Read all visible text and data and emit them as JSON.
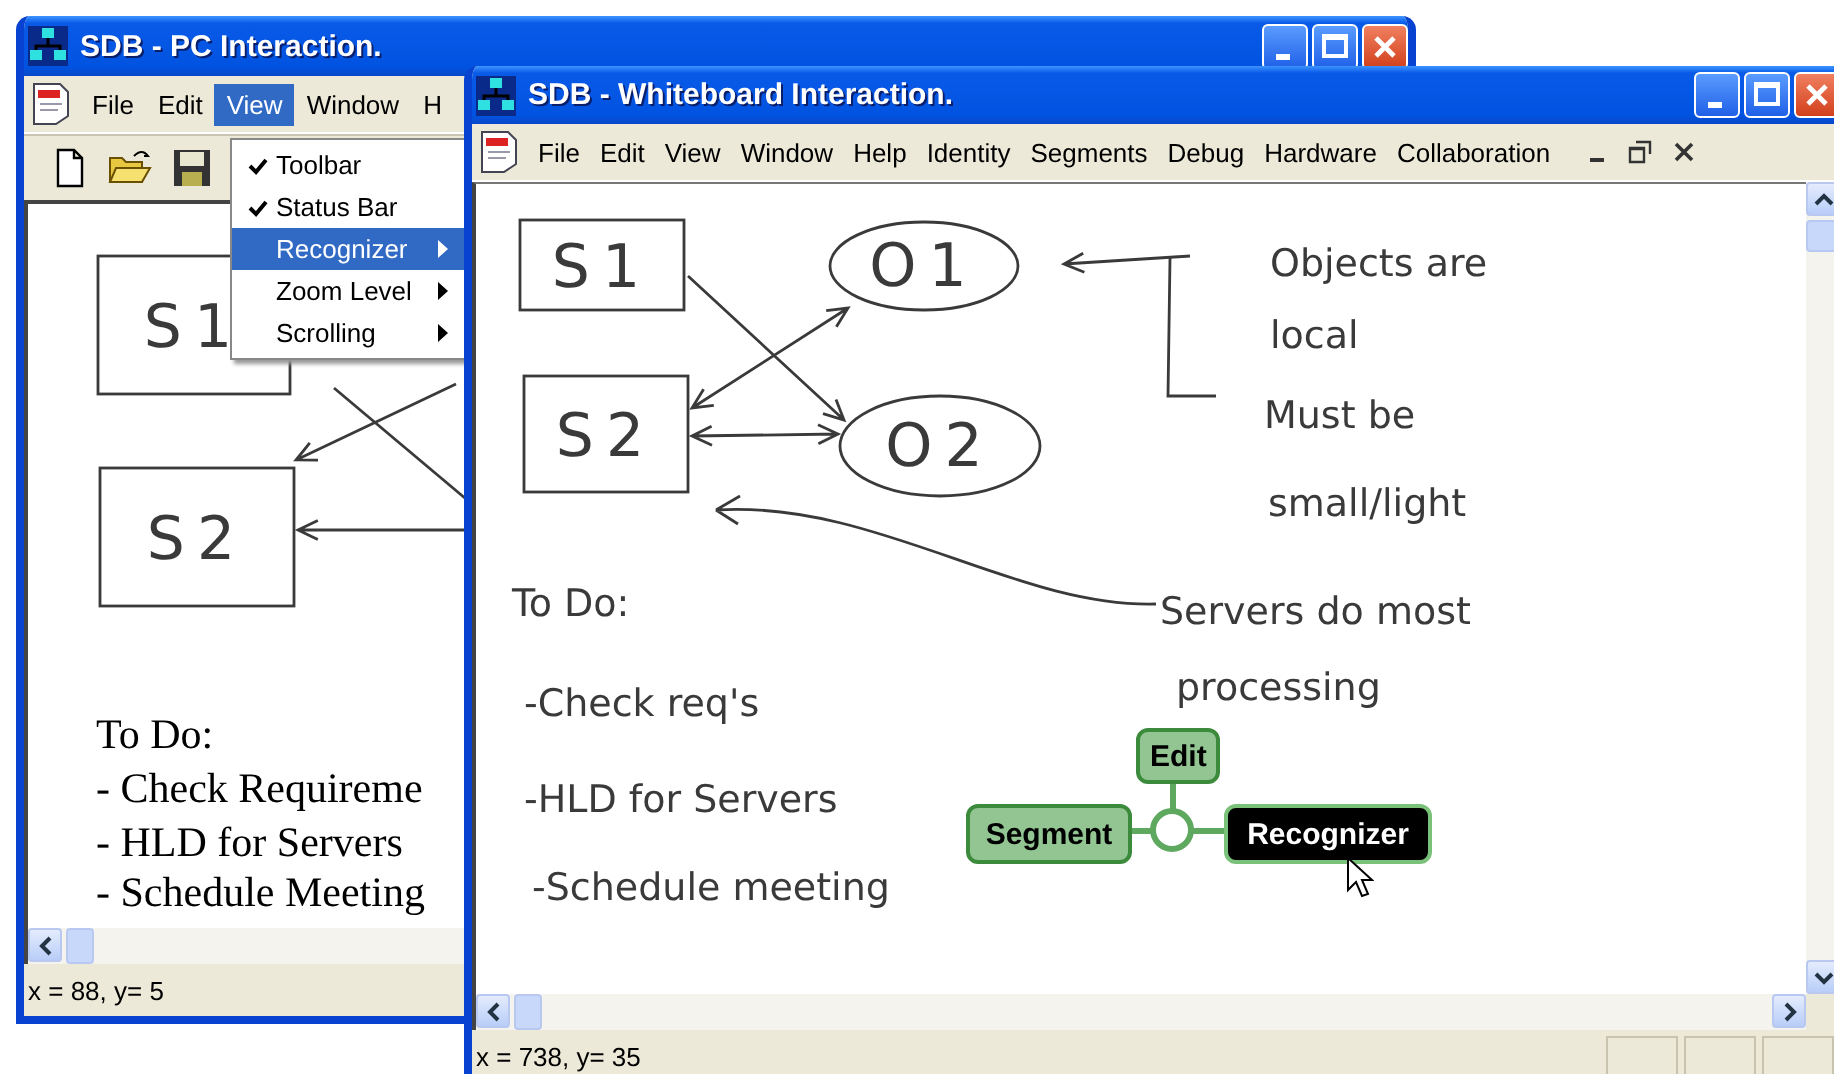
{
  "pc_window": {
    "kind": "pc",
    "title": "SDB - PC Interaction.",
    "menu": [
      {
        "label": "File",
        "selected": false
      },
      {
        "label": "Edit",
        "selected": false
      },
      {
        "label": "View",
        "selected": true
      },
      {
        "label": "Window",
        "selected": false
      },
      {
        "label": "H",
        "selected": false
      }
    ],
    "view_menu": [
      {
        "label": "Toolbar",
        "checked": true,
        "submenu": false,
        "selected": false
      },
      {
        "label": "Status Bar",
        "checked": true,
        "submenu": false,
        "selected": false
      },
      {
        "label": "Recognizer",
        "checked": false,
        "submenu": true,
        "selected": true
      },
      {
        "label": "Zoom Level",
        "checked": false,
        "submenu": true,
        "selected": false
      },
      {
        "label": "Scrolling",
        "checked": false,
        "submenu": true,
        "selected": false
      }
    ],
    "canvas": {
      "shapes": [
        {
          "kind": "box",
          "label": "S1"
        },
        {
          "kind": "box",
          "label": "S2"
        }
      ],
      "todo": [
        "To Do:",
        "- Check Requireme",
        "- HLD for Servers",
        "- Schedule Meeting"
      ]
    },
    "status": "x = 88, y= 5"
  },
  "whiteboard_window": {
    "kind": "whiteboard",
    "title": "SDB - Whiteboard Interaction.",
    "menu": [
      "File",
      "Edit",
      "View",
      "Window",
      "Help",
      "Identity",
      "Segments",
      "Debug",
      "Hardware",
      "Collaboration"
    ],
    "canvas": {
      "shapes": [
        {
          "kind": "box",
          "label": "S1"
        },
        {
          "kind": "ellipse",
          "label": "O1"
        },
        {
          "kind": "box",
          "label": "S2"
        },
        {
          "kind": "ellipse",
          "label": "O2"
        }
      ],
      "notes": [
        "Objects are",
        "local",
        "Must be",
        "small/light",
        "Servers do most",
        "processing"
      ],
      "todo": [
        "To Do:",
        "-Check req's",
        "-HLD for Servers",
        "-Schedule meeting"
      ]
    },
    "pie_menu": [
      {
        "label": "Edit",
        "selected": false
      },
      {
        "label": "Segment",
        "selected": false
      },
      {
        "label": "Recognizer",
        "selected": true
      }
    ],
    "status": "x = 738, y= 35"
  }
}
